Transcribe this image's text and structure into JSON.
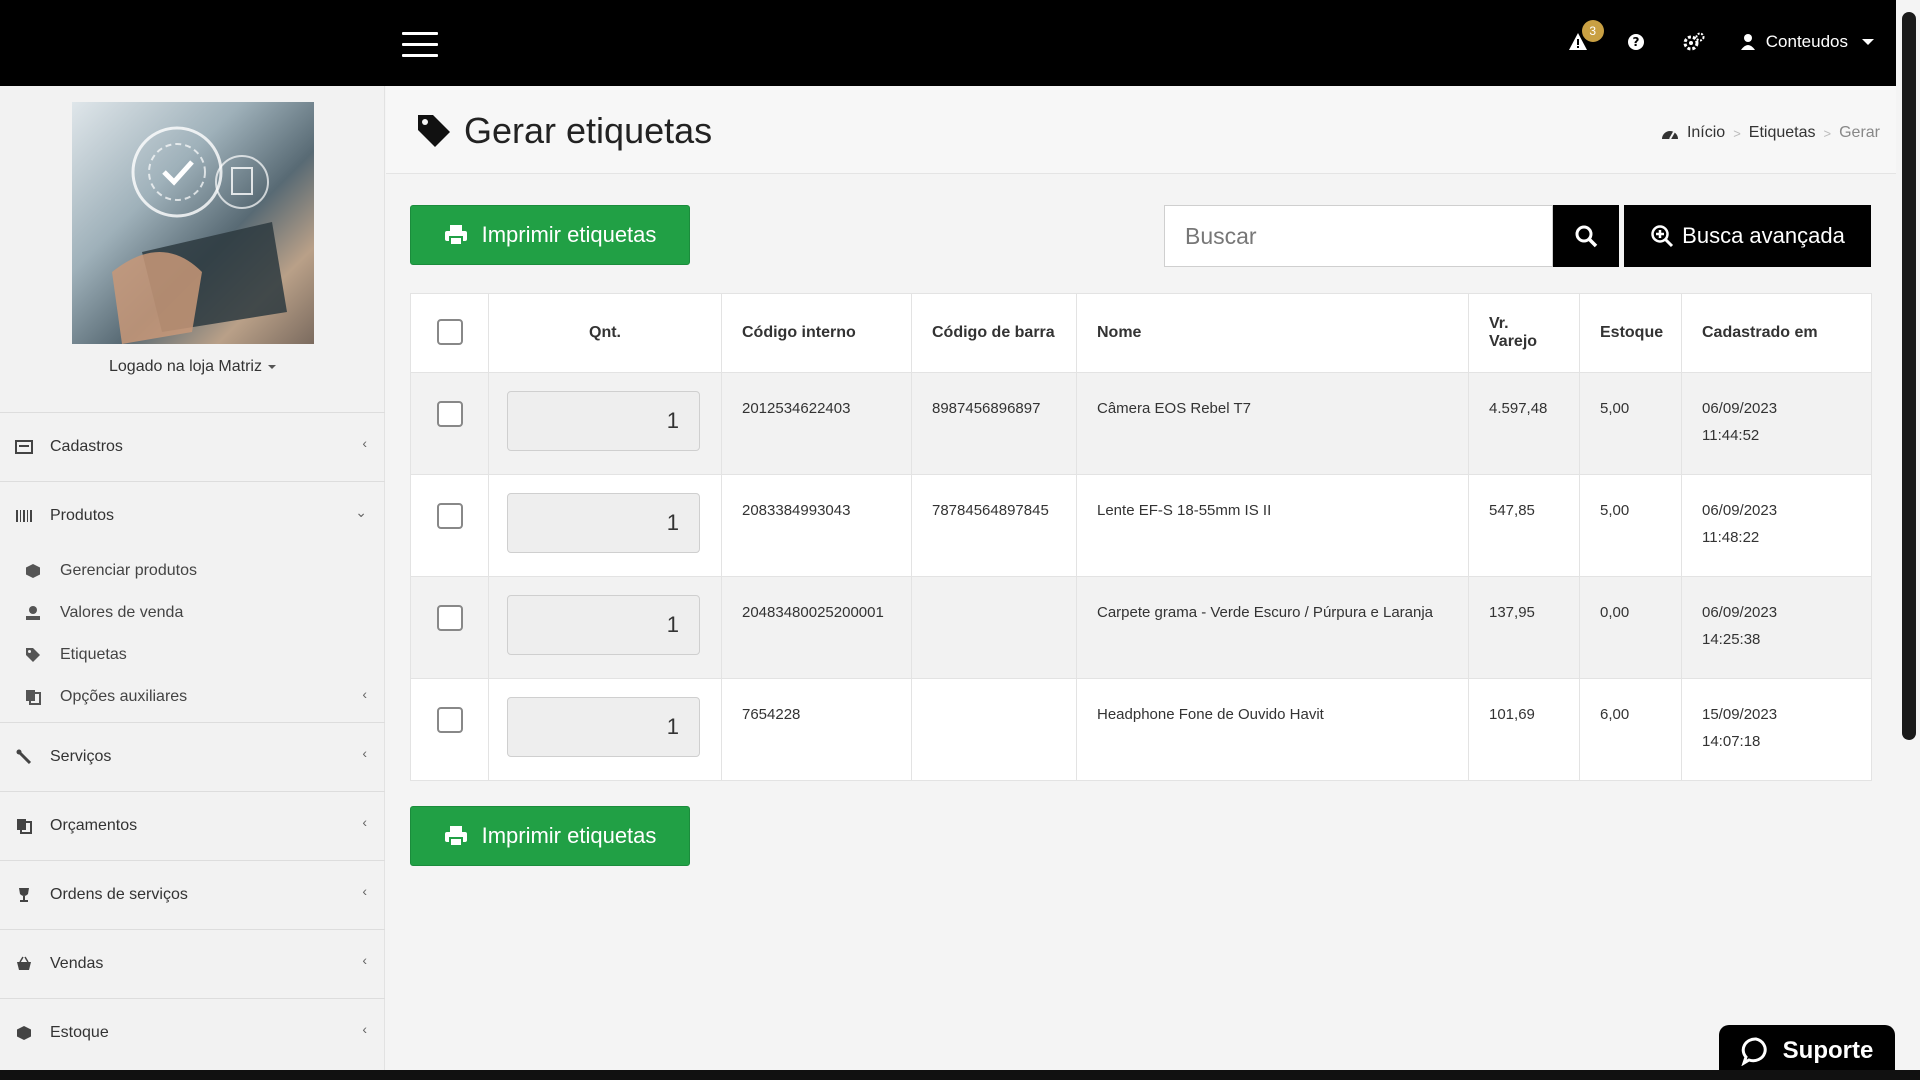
{
  "topbar": {
    "notification_count": "3",
    "user_label": "Conteudos"
  },
  "sidebar": {
    "store_label": "Logado na loja Matriz",
    "items": [
      {
        "label": "Cadastros",
        "icon": "id-card-icon"
      },
      {
        "label": "Produtos",
        "icon": "barcode-icon",
        "open": true
      },
      {
        "label": "Serviços",
        "icon": "wrench-icon"
      },
      {
        "label": "Orçamentos",
        "icon": "copy-icon"
      },
      {
        "label": "Ordens de serviços",
        "icon": "trophy-icon"
      },
      {
        "label": "Vendas",
        "icon": "basket-icon"
      },
      {
        "label": "Estoque",
        "icon": "box-icon"
      }
    ],
    "produtos_sub": [
      {
        "label": "Gerenciar produtos",
        "icon": "cube-icon"
      },
      {
        "label": "Valores de venda",
        "icon": "money-icon"
      },
      {
        "label": "Etiquetas",
        "icon": "tag-icon"
      },
      {
        "label": "Opções auxiliares",
        "icon": "copy-icon"
      }
    ]
  },
  "header": {
    "title": "Gerar etiquetas",
    "breadcrumb": [
      "Início",
      "Etiquetas",
      "Gerar"
    ]
  },
  "actions": {
    "print_label": "Imprimir etiquetas",
    "search_placeholder": "Buscar",
    "advanced_search_label": "Busca avançada"
  },
  "table": {
    "columns": [
      "Qnt.",
      "Código interno",
      "Código de barra",
      "Nome",
      "Vr. Varejo",
      "Estoque",
      "Cadastrado em"
    ],
    "rows": [
      {
        "qty": "1",
        "internal_code": "2012534622403",
        "barcode": "8987456896897",
        "name": "Câmera EOS Rebel T7",
        "price": "4.597,48",
        "stock": "5,00",
        "date": "06/09/2023",
        "time": "11:44:52"
      },
      {
        "qty": "1",
        "internal_code": "2083384993043",
        "barcode": "78784564897845",
        "name": "Lente EF-S 18-55mm IS II",
        "price": "547,85",
        "stock": "5,00",
        "date": "06/09/2023",
        "time": "11:48:22"
      },
      {
        "qty": "1",
        "internal_code": "20483480025200001",
        "barcode": "",
        "name": "Carpete grama - Verde Escuro / Púrpura e Laranja",
        "price": "137,95",
        "stock": "0,00",
        "date": "06/09/2023",
        "time": "14:25:38"
      },
      {
        "qty": "1",
        "internal_code": "7654228",
        "barcode": "",
        "name": "Headphone Fone de Ouvido Havit",
        "price": "101,69",
        "stock": "6,00",
        "date": "15/09/2023",
        "time": "14:07:18"
      }
    ]
  },
  "support": {
    "label": "Suporte"
  },
  "colors": {
    "primary_green": "#21a045",
    "topbar": "#000000",
    "badge": "#c9a043"
  }
}
